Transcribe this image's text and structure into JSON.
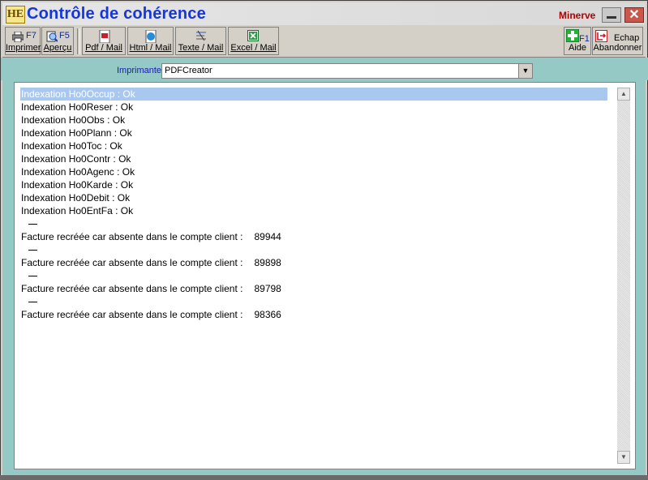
{
  "window": {
    "title": "Contrôle de cohérence",
    "brand": "Minerve",
    "icon": "app-logo"
  },
  "toolbar": {
    "print": {
      "key": "F7",
      "label": "Imprimer"
    },
    "preview": {
      "key": "F5",
      "label": "Aperçu"
    },
    "pdf": {
      "label": "Pdf / Mail"
    },
    "html": {
      "label": "Html / Mail"
    },
    "text": {
      "label": "Texte / Mail"
    },
    "excel": {
      "label": "Excel / Mail"
    },
    "help": {
      "key": "F1",
      "label": "Aide"
    },
    "cancel": {
      "key": "Echap",
      "label": "Abandonner"
    }
  },
  "printer": {
    "label": "Imprimante",
    "value": "PDFCreator"
  },
  "list": {
    "index_lines": [
      "Indexation Ho0Occup : Ok",
      "Indexation Ho0Reser : Ok",
      "Indexation Ho0Obs : Ok",
      "Indexation Ho0Plann : Ok",
      "Indexation Ho0Toc : Ok",
      "Indexation Ho0Contr : Ok",
      "Indexation Ho0Agenc : Ok",
      "Indexation Ho0Karde : Ok",
      "Indexation Ho0Debit : Ok",
      "Indexation Ho0EntFa : Ok"
    ],
    "invoice_text": "Facture recréée car absente dans le compte client :",
    "invoices": [
      "89944",
      "89898",
      "89798",
      "98366"
    ]
  }
}
